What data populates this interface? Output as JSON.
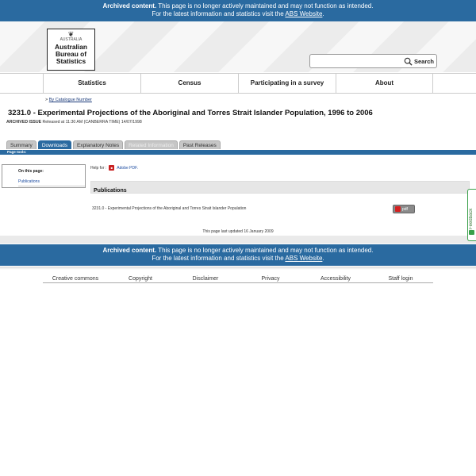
{
  "archive_banner": {
    "strong": "Archived content.",
    "message": " This page is no longer actively maintained and may not function as intended.",
    "line2_prefix": "For the latest information and statistics visit the ",
    "link": "ABS Website",
    "line2_suffix": "."
  },
  "logo": {
    "crest_text": "AUSTRALIA",
    "line1": "Australian",
    "line2": "Bureau of",
    "line3": "Statistics"
  },
  "search": {
    "value": "",
    "placeholder": "",
    "button_label": "Search",
    "icon": "search-icon"
  },
  "nav": {
    "items": [
      "Statistics",
      "Census",
      "Participating in a survey",
      "About"
    ]
  },
  "breadcrumb": {
    "prefix": "> ",
    "link": "By Catalogue Number"
  },
  "title": "3231.0 - Experimental Projections of the Aboriginal and Torres Strait Islander Population, 1996 to 2006",
  "issue": {
    "label": "ARCHIVED ISSUE",
    "released": " Released at 11:30 AM (CANBERRA TIME) 14/07/1998"
  },
  "tabs": [
    {
      "label": "Summary",
      "state": "normal"
    },
    {
      "label": "Downloads",
      "state": "active"
    },
    {
      "label": "Explanatory Notes",
      "state": "normal"
    },
    {
      "label": "Related Information",
      "state": "disabled"
    },
    {
      "label": "Past Releases",
      "state": "normal"
    }
  ],
  "page_tools": "Page tools:",
  "on_this_page": {
    "heading": "On this page:",
    "links": [
      "Publications"
    ]
  },
  "help_for": {
    "label": "Help for :",
    "link": "Adobe PDF."
  },
  "publications": {
    "heading": "Publications",
    "rows": [
      {
        "name": "3231.0 - Experimental Projections of the Aboriginal and Torres Strait Islander Population",
        "button": "pdf"
      }
    ]
  },
  "last_updated": "This page last updated 16 January 2009",
  "feedback": "Feedback",
  "footer": {
    "links": [
      "Creative commons",
      "Copyright",
      "Disclaimer",
      "Privacy",
      "Accessibility",
      "Staff login"
    ]
  },
  "colors": {
    "brand_blue": "#2a6aa0",
    "pdf_red": "#c81f1f",
    "feedback_green": "#3aa04a"
  }
}
